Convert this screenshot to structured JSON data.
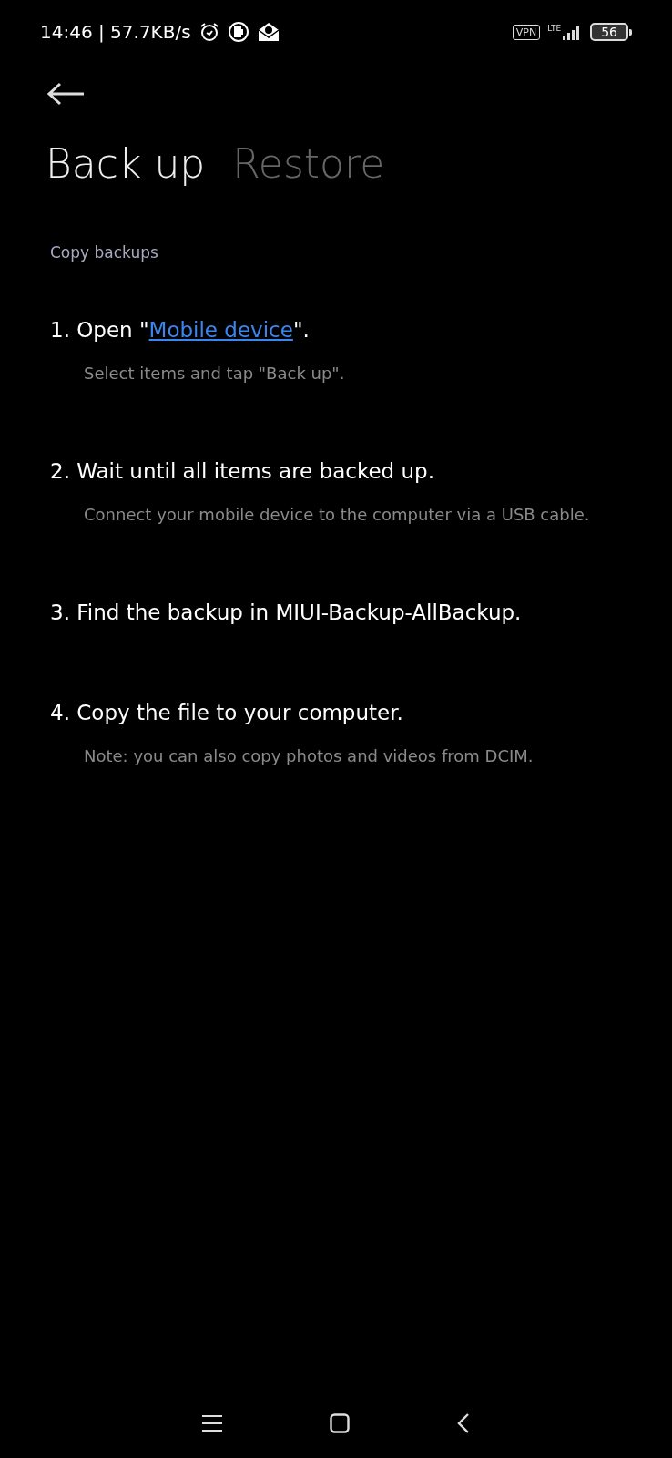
{
  "status_bar": {
    "time": "14:46 | 57.7KB/s",
    "vpn": "VPN",
    "network": "LTE",
    "battery": "56"
  },
  "tabs": [
    {
      "label": "Back up",
      "selected": true
    },
    {
      "label": "Restore",
      "selected": false
    }
  ],
  "section_title": "Copy backups",
  "steps": [
    {
      "title_before": "1. Open \"",
      "link": "Mobile device",
      "title_after": "\".",
      "note": "Select items and tap \"Back up\"."
    },
    {
      "title_before": "2. Wait until all items are backed up.",
      "note": "Connect your mobile device to the computer via a USB cable."
    },
    {
      "title_before": "3. Find the backup in MIUI-Backup-AllBackup."
    },
    {
      "title_before": "4. Copy the file to your computer.",
      "note": "Note: you can also copy photos and videos from DCIM."
    }
  ]
}
